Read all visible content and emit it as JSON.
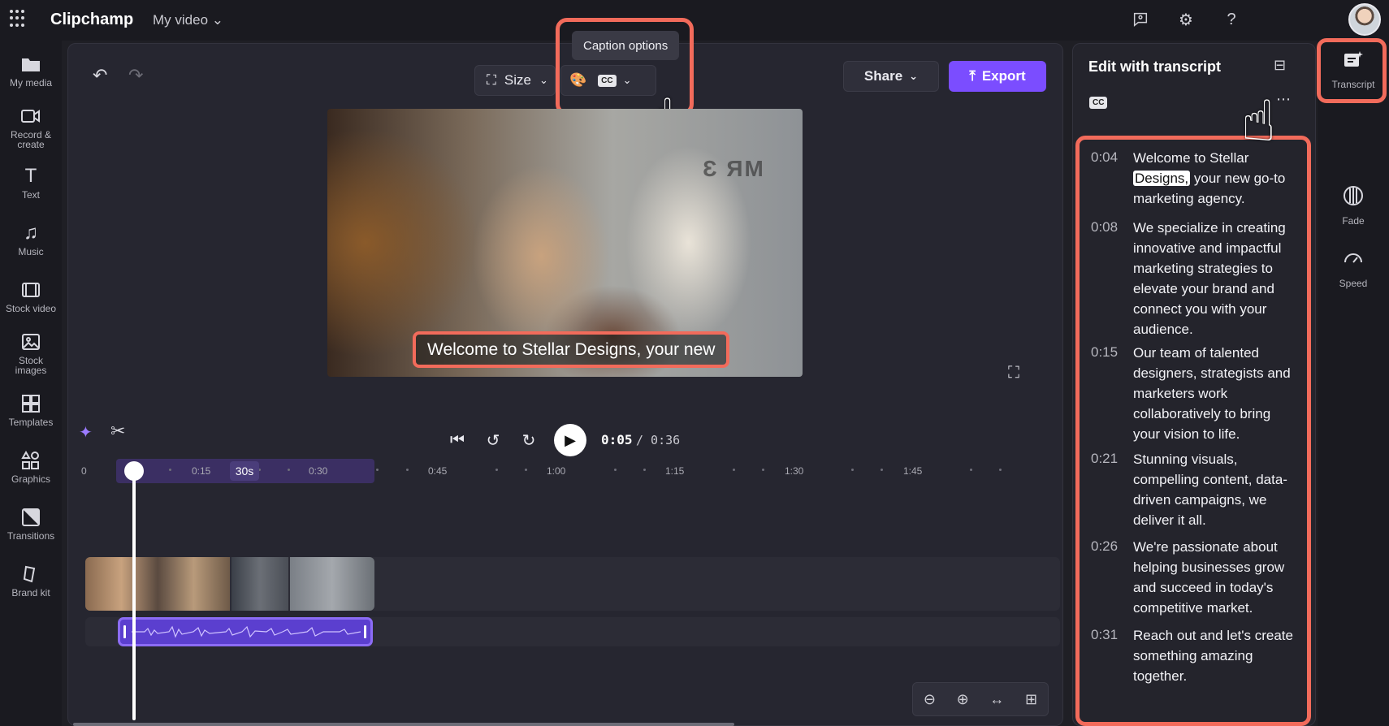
{
  "app": {
    "name": "Clipchamp",
    "project_title": "My video"
  },
  "sidebar": {
    "items": [
      {
        "label": "My media",
        "icon": "folder-icon"
      },
      {
        "label": "Record & create",
        "icon": "camera-icon"
      },
      {
        "label": "Text",
        "icon": "text-icon"
      },
      {
        "label": "Music",
        "icon": "music-icon"
      },
      {
        "label": "Stock video",
        "icon": "film-icon"
      },
      {
        "label": "Stock images",
        "icon": "image-icon"
      },
      {
        "label": "Templates",
        "icon": "templates-icon"
      },
      {
        "label": "Graphics",
        "icon": "shapes-icon"
      },
      {
        "label": "Transitions",
        "icon": "transitions-icon"
      },
      {
        "label": "Brand kit",
        "icon": "brand-kit-icon"
      }
    ]
  },
  "toolbar": {
    "size_label": "Size",
    "tooltip": "Caption options",
    "cc_label": "CC",
    "share_label": "Share",
    "export_label": "Export"
  },
  "preview": {
    "caption_text": "Welcome to Stellar Designs, your new",
    "sign_text": "Ɛ ЯM"
  },
  "playback": {
    "current": "0:05",
    "total": "/ 0:36"
  },
  "timeline": {
    "zoom_badge": "30s",
    "ticks": [
      "0",
      "0:15",
      "0:30",
      "0:45",
      "1:00",
      "1:15",
      "1:30",
      "1:45"
    ]
  },
  "transcript": {
    "title": "Edit with transcript",
    "cc_badge": "CC",
    "entries": [
      {
        "time": "0:04",
        "before": "Welcome to Stellar ",
        "highlight": "Designs,",
        "after": " your new go-to marketing agency."
      },
      {
        "time": "0:08",
        "text": "We specialize in creating innovative and impactful marketing strategies to elevate your brand and connect you with your audience."
      },
      {
        "time": "0:15",
        "text": "Our team of talented designers, strategists and marketers work collaboratively to bring your vision to life."
      },
      {
        "time": "0:21",
        "text": "Stunning visuals, compelling content, data-driven campaigns, we deliver it all."
      },
      {
        "time": "0:26",
        "text": "We're passionate about helping businesses grow and succeed in today's competitive market."
      },
      {
        "time": "0:31",
        "text": "Reach out and let's create something amazing together."
      }
    ]
  },
  "rail": {
    "items": [
      {
        "label": "Transcript",
        "icon": "transcript-icon"
      },
      {
        "label": "Fade",
        "icon": "fade-icon"
      },
      {
        "label": "Speed",
        "icon": "speed-icon"
      }
    ]
  },
  "colors": {
    "accent": "#7b4dff",
    "highlight": "#f26b5b",
    "audio_clip": "#5b3fcf"
  }
}
